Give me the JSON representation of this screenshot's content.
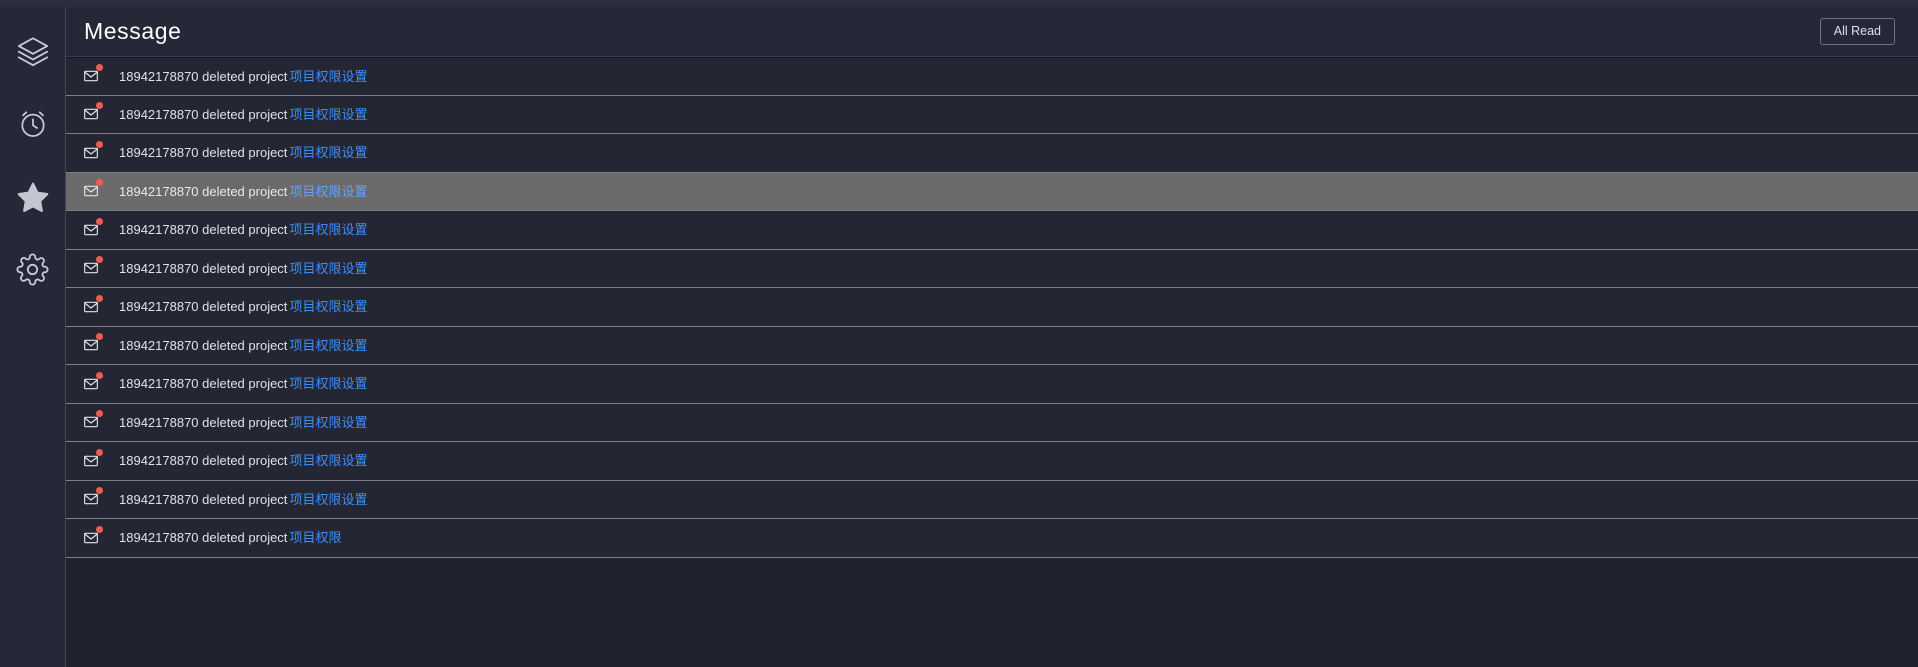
{
  "theme": {
    "page_bg": "#20222e",
    "rail_bg": "#252837",
    "header_bg": "#252837",
    "row_bg": "#242733",
    "row_hover_bg": "#6a6a6a",
    "divider": "#7a7f8c",
    "link_color": "#3e8ef7",
    "unread_dot_color": "#f05b52",
    "text_color": "#dfe2ea",
    "title_color": "#ffffff"
  },
  "sidebar": {
    "items": [
      {
        "name": "layers",
        "icon": "layers-icon",
        "active": false
      },
      {
        "name": "clock",
        "icon": "alarm-clock-icon",
        "active": false
      },
      {
        "name": "star",
        "icon": "star-icon",
        "active": true
      },
      {
        "name": "settings",
        "icon": "gear-icon",
        "active": false
      }
    ]
  },
  "header": {
    "title": "Message",
    "all_read_label": "All Read"
  },
  "messages": {
    "row_icon": "envelope-icon",
    "unread_badge": "unread-dot",
    "items": [
      {
        "text": "18942178870 deleted project",
        "link": "项目权限设置",
        "unread": true,
        "hovered": false
      },
      {
        "text": "18942178870 deleted project",
        "link": "项目权限设置",
        "unread": true,
        "hovered": false
      },
      {
        "text": "18942178870 deleted project",
        "link": "项目权限设置",
        "unread": true,
        "hovered": false
      },
      {
        "text": "18942178870 deleted project",
        "link": "项目权限设置",
        "unread": true,
        "hovered": true
      },
      {
        "text": "18942178870 deleted project",
        "link": "项目权限设置",
        "unread": true,
        "hovered": false
      },
      {
        "text": "18942178870 deleted project",
        "link": "项目权限设置",
        "unread": true,
        "hovered": false
      },
      {
        "text": "18942178870 deleted project",
        "link": "项目权限设置",
        "unread": true,
        "hovered": false
      },
      {
        "text": "18942178870 deleted project",
        "link": "项目权限设置",
        "unread": true,
        "hovered": false
      },
      {
        "text": "18942178870 deleted project",
        "link": "项目权限设置",
        "unread": true,
        "hovered": false
      },
      {
        "text": "18942178870 deleted project",
        "link": "项目权限设置",
        "unread": true,
        "hovered": false
      },
      {
        "text": "18942178870 deleted project",
        "link": "项目权限设置",
        "unread": true,
        "hovered": false
      },
      {
        "text": "18942178870 deleted project",
        "link": "项目权限设置",
        "unread": true,
        "hovered": false
      },
      {
        "text": "18942178870 deleted project",
        "link": "项目权限",
        "unread": true,
        "hovered": false
      }
    ]
  }
}
